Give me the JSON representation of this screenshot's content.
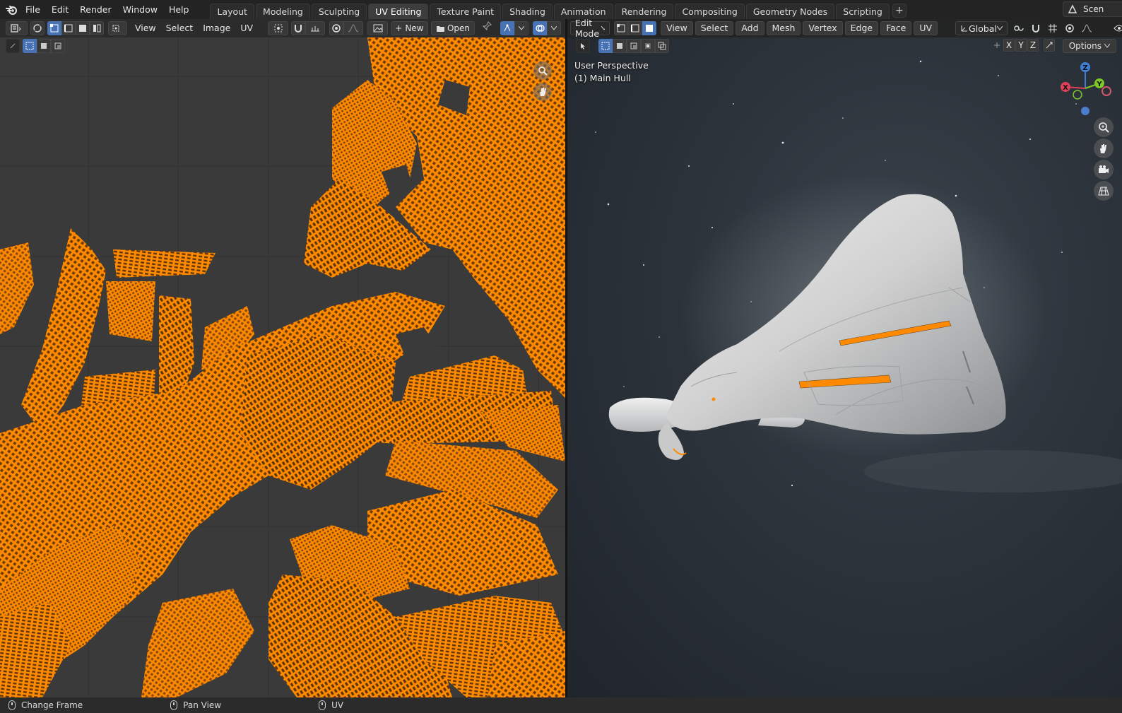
{
  "app": {
    "menu": [
      "File",
      "Edit",
      "Render",
      "Window",
      "Help"
    ],
    "workspace_tabs": [
      "Layout",
      "Modeling",
      "Sculpting",
      "UV Editing",
      "Texture Paint",
      "Shading",
      "Animation",
      "Rendering",
      "Compositing",
      "Geometry Nodes",
      "Scripting"
    ],
    "active_tab": "UV Editing",
    "add_tab_label": "+",
    "scene_label": "Scen"
  },
  "uv_editor": {
    "menus": [
      "View",
      "Select",
      "Image",
      "UV"
    ],
    "new_label": "New",
    "new_prefix": "+",
    "open_label": "Open",
    "uv_color": "#ff8a00",
    "background_color": "#3a3a3a"
  },
  "viewport": {
    "mode": "Edit Mode",
    "menus": [
      "View",
      "Select",
      "Add",
      "Mesh",
      "Vertex",
      "Edge",
      "Face",
      "UV"
    ],
    "transform_orientation": "Global",
    "perspective_label": "User Perspective",
    "object_label": "(1) Main Hull",
    "axis_buttons": [
      "X",
      "Y",
      "Z"
    ],
    "options_label": "Options",
    "gizmo_axes": {
      "x": "X",
      "y": "Y",
      "z": "Z"
    },
    "gizmo_colors": {
      "x": "#e0405a",
      "y": "#7ec62a",
      "z": "#3f7fd6"
    }
  },
  "statusbar": {
    "items": [
      "Change Frame",
      "Pan View",
      "UV"
    ]
  },
  "icons": [
    "blender-logo-icon",
    "editor-type-icon",
    "sync-selection-icon",
    "vertex-select-icon",
    "edge-select-icon",
    "face-select-icon",
    "island-select-icon",
    "pivot-icon",
    "snap-icon",
    "proportional-icon",
    "image-icon",
    "pin-icon",
    "overlay-icon",
    "zoom-icon",
    "hand-icon",
    "camera-icon",
    "grid-icon",
    "mouse-icon"
  ]
}
